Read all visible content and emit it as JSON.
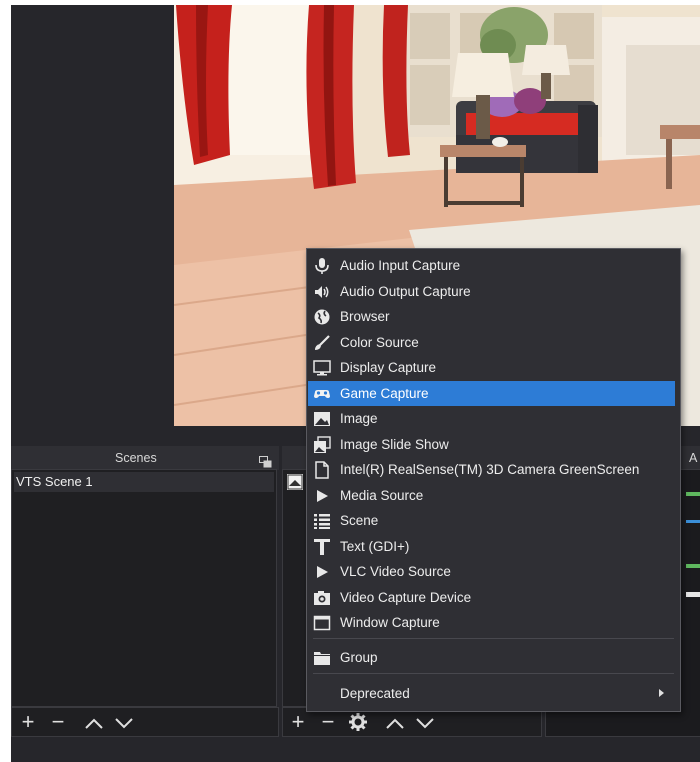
{
  "scenes_dock": {
    "title": "Scenes",
    "items": [
      "VTS Scene 1"
    ]
  },
  "mixer_dock": {
    "title_partial": "A"
  },
  "toolbar": {
    "add": "+",
    "remove": "−"
  },
  "context_menu": {
    "items": [
      {
        "label": "Audio Input Capture",
        "icon": "microphone-icon"
      },
      {
        "label": "Audio Output Capture",
        "icon": "speaker-icon"
      },
      {
        "label": "Browser",
        "icon": "globe-icon"
      },
      {
        "label": "Color Source",
        "icon": "brush-icon"
      },
      {
        "label": "Display Capture",
        "icon": "monitor-icon"
      },
      {
        "label": "Game Capture",
        "icon": "gamepad-icon",
        "highlighted": true
      },
      {
        "label": "Image",
        "icon": "image-icon"
      },
      {
        "label": "Image Slide Show",
        "icon": "slideshow-icon"
      },
      {
        "label": "Intel(R) RealSense(TM) 3D Camera GreenScreen",
        "icon": "file-icon"
      },
      {
        "label": "Media Source",
        "icon": "play-icon"
      },
      {
        "label": "Scene",
        "icon": "list-icon"
      },
      {
        "label": "Text (GDI+)",
        "icon": "text-icon"
      },
      {
        "label": "VLC Video Source",
        "icon": "play-icon"
      },
      {
        "label": "Video Capture Device",
        "icon": "camera-icon"
      },
      {
        "label": "Window Capture",
        "icon": "window-icon"
      }
    ],
    "group_label": "Group",
    "deprecated_label": "Deprecated"
  },
  "colors": {
    "highlight": "#2d7cd6",
    "menu_bg": "#2f2f34",
    "app_bg": "#26262b"
  }
}
